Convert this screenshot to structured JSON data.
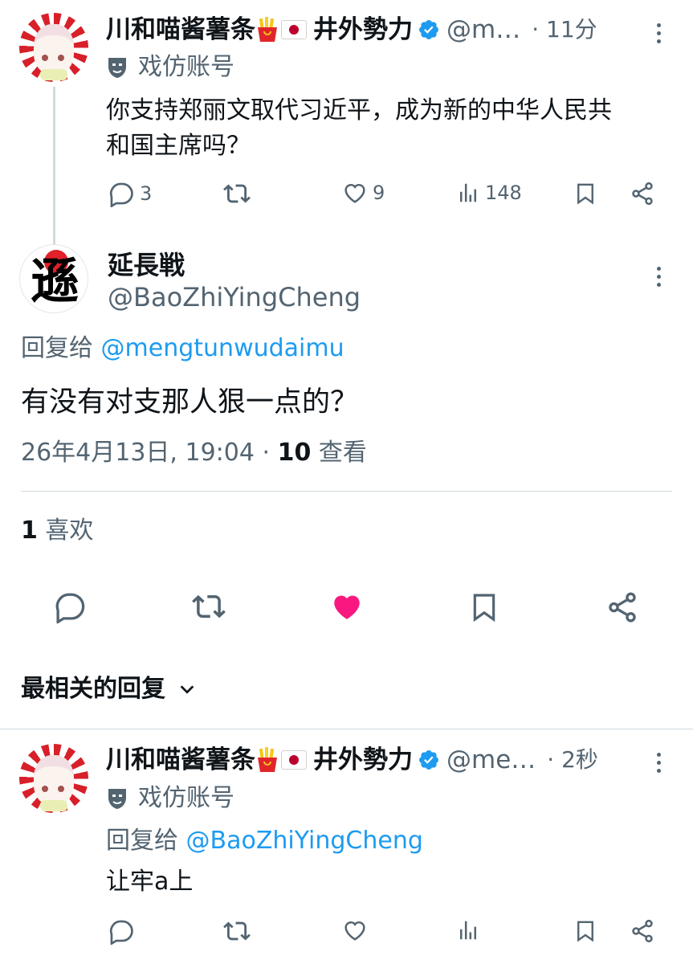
{
  "tweet1": {
    "name": "川和喵酱薯条",
    "name_suffix": "井外勢力",
    "handle": "@m…",
    "time": "· 11分",
    "parody_label": "戏仿账号",
    "text_line1": "你支持郑丽文取代习近平，成为新的中华人民共",
    "text_line2": "和国主席吗？",
    "replies": "3",
    "likes": "9",
    "views": "148"
  },
  "main": {
    "name": "延長戦",
    "handle": "@BaoZhiYingCheng",
    "avatar_glyph": "遜",
    "reply_to_label": "回复给",
    "reply_to_handle": "@mengtunwudaimu",
    "text": "有没有对支那人狠一点的？",
    "date": "26年4月13日, 19:04 ·",
    "views_count": "10",
    "views_label": "查看",
    "likes_count": "1",
    "likes_label": "喜欢",
    "like_color": "#f91880"
  },
  "replies_header": {
    "label": "最相关的回复"
  },
  "reply": {
    "name": "川和喵酱薯条",
    "name_suffix": "井外勢力",
    "handle": "@me…",
    "time": "· 2秒",
    "parody_label": "戏仿账号",
    "reply_to_label": "回复给",
    "reply_to_handle": "@BaoZhiYingCheng",
    "text": "让牢a上"
  },
  "colors": {
    "accent": "#1d9bf0",
    "secondary_text": "#536471",
    "like": "#f91880"
  }
}
